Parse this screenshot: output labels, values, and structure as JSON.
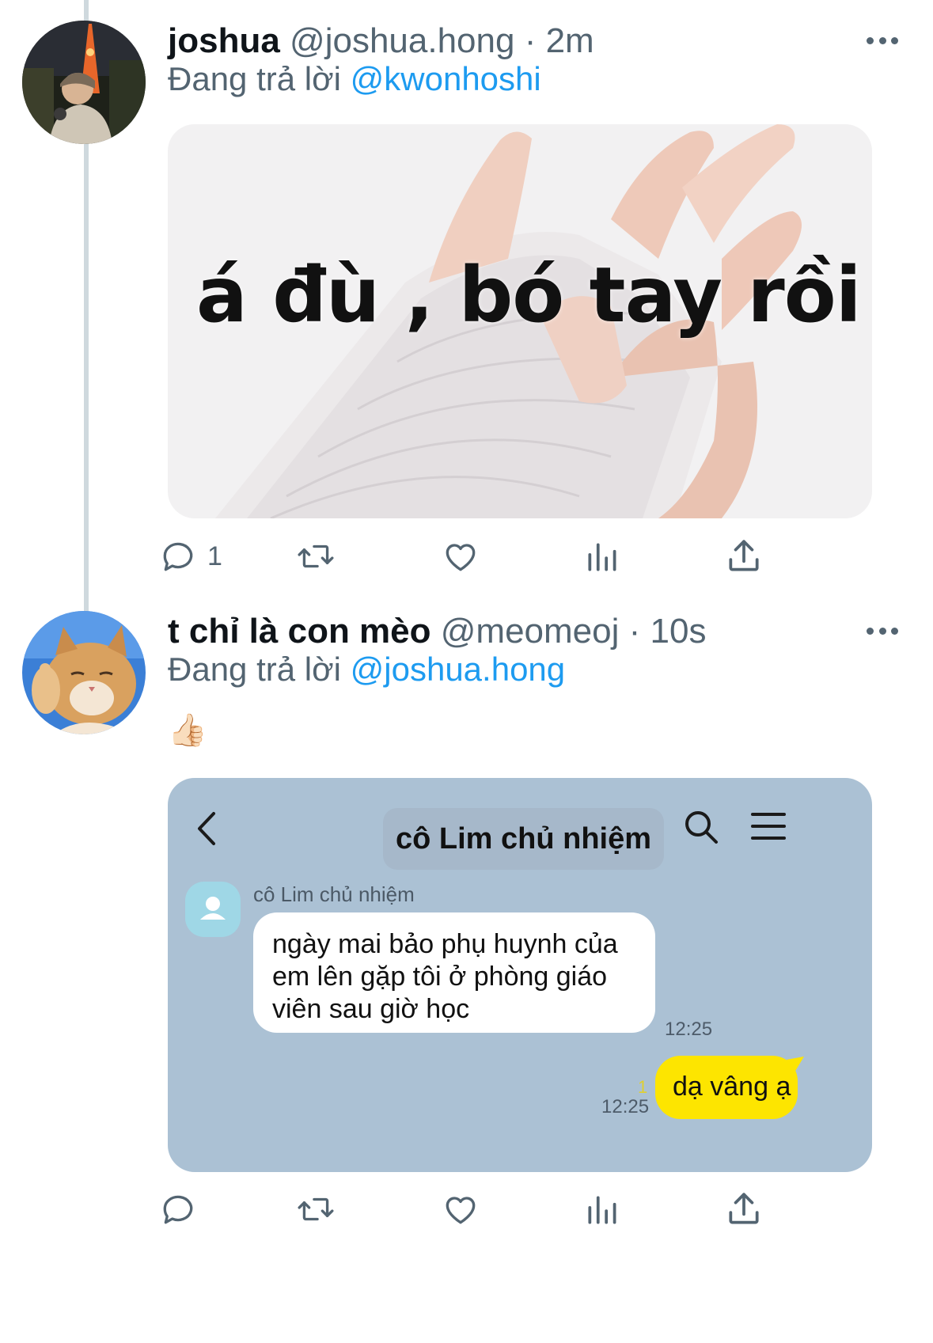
{
  "tweet1": {
    "display_name": "joshua",
    "handle": "@joshua.hong",
    "time": "· 2m",
    "replying_prefix": "Đang trả lời",
    "replying_to": "@kwonhoshi",
    "meme_text": "á đù , bó tay rồi",
    "actions": {
      "reply_count": "1"
    }
  },
  "tweet2": {
    "display_name": "t chỉ là con mèo",
    "handle": "@meomeoj",
    "time": "· 10s",
    "replying_prefix": "Đang trả lời",
    "replying_to": "@joshua.hong",
    "body_emoji": "👍🏻",
    "chat": {
      "title": "cô Lim chủ nhiệm",
      "sender_name": "cô Lim chủ nhiệm",
      "incoming_message": "ngày mai bảo phụ huynh của em lên gặp tôi ở phòng giáo viên sau giờ học",
      "incoming_time": "12:25",
      "outgoing_message": "dạ vâng ạ",
      "outgoing_time": "12:25",
      "unread_count": "1",
      "bg_color": "#abc1d4",
      "outgoing_bubble_color": "#fde500"
    }
  },
  "colors": {
    "link": "#1d9bf0",
    "muted": "#536471"
  },
  "icons": [
    "more-icon",
    "reply-icon",
    "retweet-icon",
    "like-icon",
    "analytics-icon",
    "share-icon",
    "back-arrow-icon",
    "search-icon",
    "hamburger-menu-icon",
    "default-avatar-icon"
  ]
}
